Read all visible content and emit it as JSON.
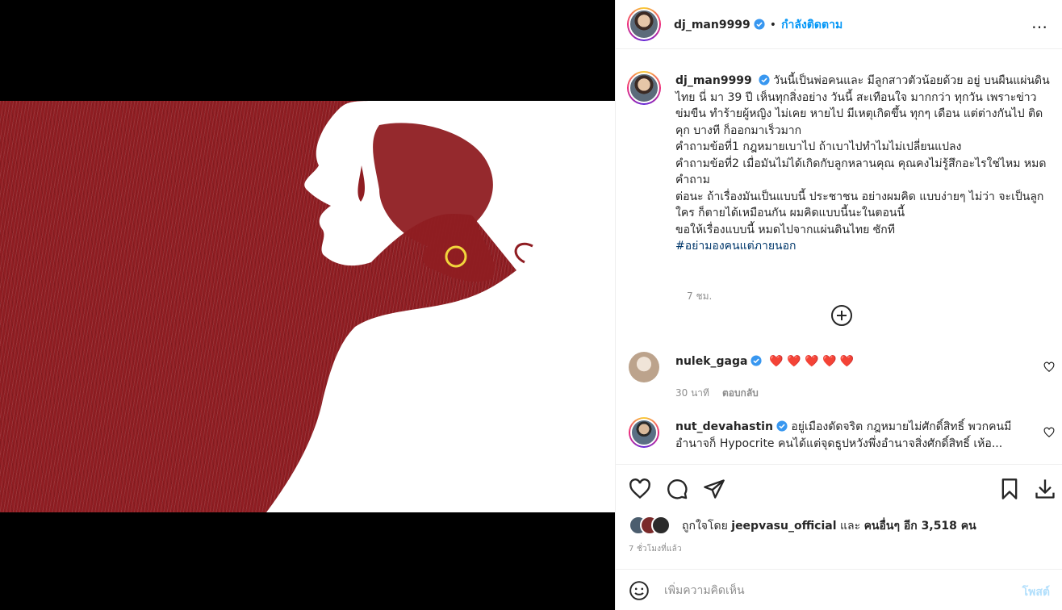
{
  "header": {
    "username": "dj_man9999",
    "separator": "•",
    "follow_status": "กำลังติดตาม",
    "more_icon": "…"
  },
  "caption": {
    "username": "dj_man9999",
    "text": "วันนี้เป็นพ่อคนและ มีลูกสาวตัวน้อยด้วย อยู่ บนผืนแผ่นดินไทย นี่ มา 39 ปี เห็นทุกสิ่งอย่าง วันนี้ สะเทือนใจ มากกว่า ทุกวัน เพราะข่าวข่มขืน ทำร้ายผู้หญิง ไม่เคย หายไป มีเหตุเกิดขึ้น ทุกๆ เดือน แต่ต่างกันไป ติดคุก บางที ก็ออกมาเร็วมาก\nคำถามข้อที่1 กฎหมายเบาไป ถ้าเบาไปทำไมไม่เปลี่ยนแปลง\nคำถามข้อที่2 เมื่อมันไม่ได้เกิดกับลูกหลานคุณ คุณคงไม่รู้สึกอะไรใช่ไหม หมดคำถาม\nต่อนะ ถ้าเรื่องมันเป็นแบบนี้ ประชาชน อย่างผมคิด แบบง่ายๆ ไม่ว่า จะเป็นลูกใคร ก็ตายได้เหมือนกัน ผมคิดแบบนี้นะในตอนนี้\nขอให้เรื่องแบบนี้ หมดไปจากแผ่นดินไทย ซักที",
    "hashtag": "#อย่ามองคนแต่ภายนอก",
    "time": "7 ชม."
  },
  "comments": [
    {
      "username": "nulek_gaga",
      "text": "❤️ ❤️ ❤️ ❤️ ❤️",
      "time": "30 นาที",
      "reply": "ตอบกลับ"
    },
    {
      "username": "nut_devahastin",
      "text": "อยู่เมืองดัดจริต กฎหมายไม่ศักดิ์สิทธิ์ พวกคนมีอำนาจก็ Hypocrite คนได้แต่จุดธูปหวังพึ่งอำนาจสิ่งศักดิ์สิทธิ์ เห้อ..."
    }
  ],
  "likes": {
    "prefix": "ถูกใจโดย",
    "first_liker": "jeepvasu_official",
    "connector": "และ",
    "others": "คนอื่นๆ อีก 3,518 คน"
  },
  "post_time": "7 ชั่วโมงที่แล้ว",
  "add_comment": {
    "placeholder": "เพิ่มความคิดเห็น",
    "post_label": "โพสต์"
  },
  "colors": {
    "link": "#0095f6",
    "verified": "#3897f0",
    "heart": "#ed4956",
    "artwork_red": "#8f1d22"
  },
  "icons": [
    "heart-icon",
    "comment-icon",
    "share-icon",
    "bookmark-icon",
    "download-icon",
    "emoji-icon",
    "plus-circle-icon",
    "more-icon",
    "verified-icon"
  ]
}
